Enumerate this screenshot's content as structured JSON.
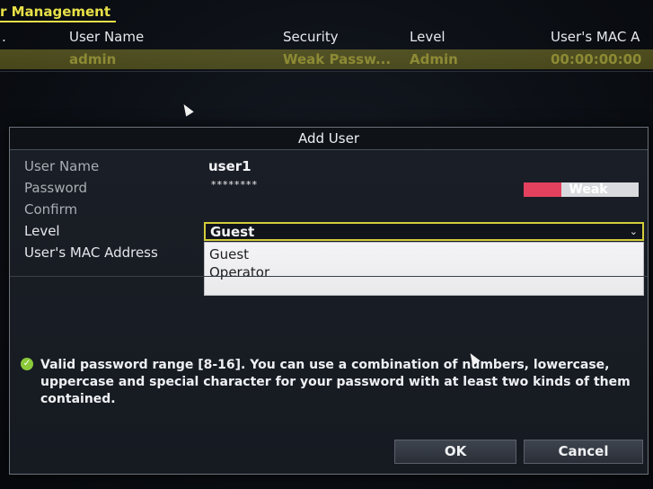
{
  "background": {
    "section_title": "r Management",
    "columns": {
      "index": ".",
      "user_name": "User Name",
      "security": "Security",
      "level": "Level",
      "mac": "User's MAC A"
    },
    "row": {
      "user_name": "admin",
      "security": "Weak Passw...",
      "level": "Admin",
      "mac": "00:00:00:00"
    }
  },
  "dialog": {
    "title": "Add User",
    "labels": {
      "user_name": "User Name",
      "password": "Password",
      "confirm": "Confirm",
      "level": "Level",
      "mac": "User's MAC Address"
    },
    "user_name_value": "user1",
    "password_value": "********",
    "strength": {
      "label": "Weak",
      "level_fraction": 0.33,
      "color": "#e4415f"
    },
    "level_select": {
      "selected": "Guest",
      "options": [
        "Guest",
        "Operator"
      ]
    },
    "info": {
      "icon": "check-circle-icon",
      "text": "Valid password range [8-16]. You can use a combination of numbers, lowercase, uppercase and special character for your password with at least two kinds of them contained."
    },
    "buttons": {
      "ok": "OK",
      "cancel": "Cancel"
    }
  },
  "colors": {
    "accent": "#d3cc3a",
    "title_yellow": "#e8e048",
    "ok_green": "#8bc93a"
  }
}
